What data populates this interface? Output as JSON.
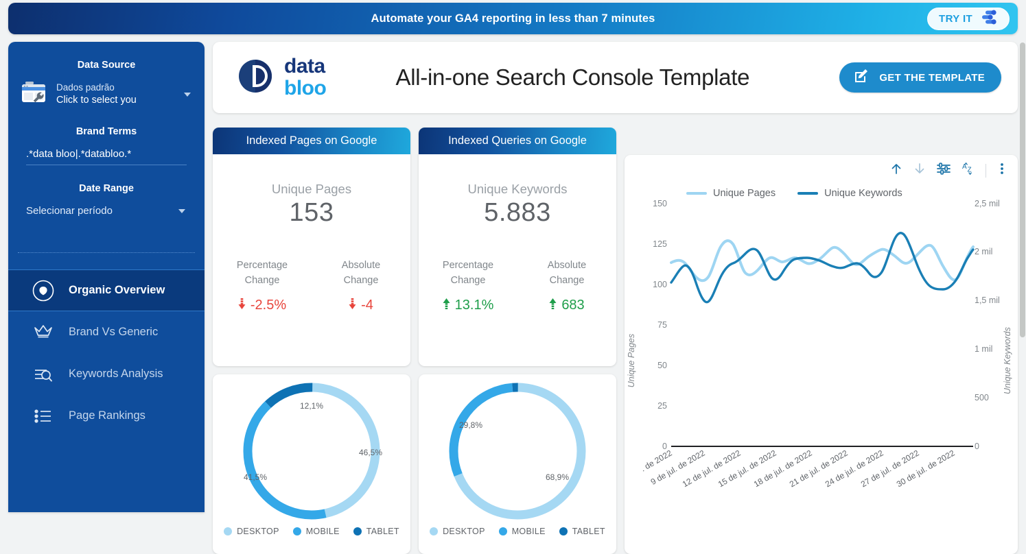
{
  "promo": {
    "text": "Automate your GA4 reporting in less than 7 minutes",
    "cta_label": "TRY IT",
    "toggle_icon": "toggles-icon"
  },
  "sidebar": {
    "data_source": {
      "title": "Data Source",
      "icon": "search-console-icon",
      "line1": "Dados padrão",
      "line2": "Click to select you",
      "caret_icon": "chevron-down-icon"
    },
    "brand_terms": {
      "title": "Brand Terms",
      "value": ".*data bloo|.*databloo.*"
    },
    "date_range": {
      "title": "Date Range",
      "value": "Selecionar período",
      "caret_icon": "chevron-down-icon"
    },
    "nav": [
      {
        "label": "Organic Overview",
        "icon": "leaf-circle-icon",
        "active": true
      },
      {
        "label": "Brand Vs Generic",
        "icon": "crown-icon",
        "active": false
      },
      {
        "label": "Keywords Analysis",
        "icon": "search-list-icon",
        "active": false
      },
      {
        "label": "Page Rankings",
        "icon": "bullet-list-icon",
        "active": false
      }
    ]
  },
  "header": {
    "logo_data": "data",
    "logo_bloo": "bloo",
    "logo_icon": "data-bloo-logo",
    "title": "All-in-one Search Console Template",
    "cta_label": "GET THE TEMPLATE",
    "cta_icon": "edit-square-icon"
  },
  "scorecards": [
    {
      "header": "Indexed Pages on Google",
      "metric_label": "Unique Pages",
      "metric_value": "153",
      "changes": [
        {
          "label_l1": "Percentage",
          "label_l2": "Change",
          "value": "-2.5%",
          "direction": "down",
          "icon": "arrow-down-icon"
        },
        {
          "label_l1": "Absolute",
          "label_l2": "Change",
          "value": "-4",
          "direction": "down",
          "icon": "arrow-down-icon"
        }
      ]
    },
    {
      "header": "Indexed Queries on Google",
      "metric_label": "Unique Keywords",
      "metric_value": "5.883",
      "changes": [
        {
          "label_l1": "Percentage",
          "label_l2": "Change",
          "value": "13.1%",
          "direction": "up",
          "icon": "arrow-up-icon"
        },
        {
          "label_l1": "Absolute",
          "label_l2": "Change",
          "value": "683",
          "direction": "up",
          "icon": "arrow-up-icon"
        }
      ]
    }
  ],
  "colors": {
    "desktop": "#a5d8f3",
    "mobile": "#34a8e8",
    "tablet": "#0e72b4",
    "unique_pages_line": "#9ed5f2",
    "unique_keywords_line": "#1a7fb5",
    "brand_navy": "#0f4d9c",
    "brand_blue": "#1e8bcc",
    "up_green": "#1e9e4a",
    "down_red": "#e8453c"
  },
  "chart_data": [
    {
      "type": "pie",
      "title": "Unique Pages by Device",
      "labels": [
        "DESKTOP",
        "MOBILE",
        "TABLET"
      ],
      "values": [
        46.5,
        41.5,
        12.1
      ],
      "value_labels": [
        "46,5%",
        "41,5%",
        "12,1%"
      ],
      "legend": [
        "DESKTOP",
        "MOBILE",
        "TABLET"
      ],
      "legend_position": "bottom",
      "donut": true
    },
    {
      "type": "pie",
      "title": "Unique Keywords by Device",
      "labels": [
        "DESKTOP",
        "MOBILE",
        "TABLET"
      ],
      "values": [
        68.9,
        29.8,
        1.3
      ],
      "value_labels": [
        "68,9%",
        "29,8%",
        ""
      ],
      "legend": [
        "DESKTOP",
        "MOBILE",
        "TABLET"
      ],
      "legend_position": "bottom",
      "donut": true
    },
    {
      "type": "line",
      "title": "",
      "xlabel": "",
      "ylabel": "Unique Pages",
      "y2label": "Unique Keywords",
      "ylim": [
        0,
        150
      ],
      "y2lim": [
        0,
        2500
      ],
      "yticks": [
        "0",
        "25",
        "50",
        "75",
        "100",
        "125",
        "150"
      ],
      "y2ticks": [
        "0",
        "500",
        "1 mil",
        "1,5 mil",
        "2 mil",
        "2,5 mil"
      ],
      "xticks": [
        ". de 2022",
        "9 de jul. de 2022",
        "12 de jul. de 2022",
        "15 de jul. de 2022",
        "18 de jul. de 2022",
        "21 de jul. de 2022",
        "24 de jul. de 2022",
        "27 de jul. de 2022",
        "30 de jul. de 2022"
      ],
      "grid": false,
      "legend": [
        "Unique Pages",
        "Unique Keywords"
      ],
      "legend_position": "top",
      "series": [
        {
          "name": "Unique Pages",
          "axis": "left",
          "values": [
            113,
            110,
            118,
            104,
            96,
            108,
            128,
            122,
            112,
            131,
            115,
            106,
            104,
            110,
            118,
            119,
            121,
            122,
            118,
            131,
            119,
            113,
            118,
            127,
            112,
            104,
            118,
            126,
            112,
            108,
            116,
            102,
            95,
            110,
            122,
            129
          ]
        },
        {
          "name": "Unique Keywords",
          "axis": "right",
          "values": [
            1900,
            1930,
            1820,
            1700,
            1640,
            1810,
            1880,
            1930,
            1950,
            2060,
            1870,
            1860,
            1900,
            1950,
            1940,
            1960,
            1950,
            1930,
            1880,
            1960,
            1950,
            1940,
            1900,
            2130,
            1960,
            1910,
            1860,
            2000,
            1890,
            1830,
            1760,
            1800,
            1870,
            1900,
            1880,
            1960
          ]
        }
      ]
    }
  ],
  "chart_toolbar": {
    "icons": [
      "arrow-up-icon",
      "arrow-down-icon",
      "filter-sliders-icon",
      "sort-az-icon",
      "more-vertical-icon"
    ]
  }
}
